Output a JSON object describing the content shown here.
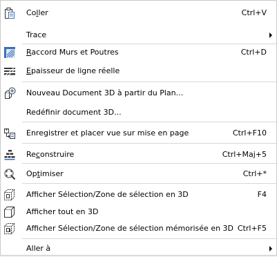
{
  "menu": {
    "items": [
      {
        "name": "coller",
        "icon": "paste-icon",
        "pre": "Co",
        "ul": "l",
        "post": "ler",
        "shortcut": "Ctrl+V",
        "submenu": false
      },
      {
        "name": "trace",
        "icon": "",
        "pre": "",
        "ul": "",
        "post": "Trace",
        "shortcut": "",
        "submenu": true
      },
      {
        "name": "raccord-murs-poutres",
        "icon": "wall-beam-join-icon",
        "pre": "",
        "ul": "R",
        "post": "accord Murs et Poutres",
        "shortcut": "Ctrl+D",
        "submenu": false
      },
      {
        "name": "epaisseur-ligne",
        "icon": "line-weight-icon",
        "pre": "",
        "ul": "E",
        "post": "paisseur de ligne réelle",
        "shortcut": "",
        "submenu": false
      },
      {
        "name": "nouveau-document-3d",
        "icon": "new-3d-document-icon",
        "pre": "",
        "ul": "",
        "post": "Nouveau Document 3D à partir du Plan...",
        "shortcut": "",
        "submenu": false
      },
      {
        "name": "redefinir-document-3d",
        "icon": "",
        "pre": "",
        "ul": "",
        "post": "Redéfinir document 3D...",
        "shortcut": "",
        "submenu": false
      },
      {
        "name": "enregistrer-placer-vue",
        "icon": "save-place-view-icon",
        "pre": "",
        "ul": "",
        "post": "Enregistrer et placer vue sur mise en page",
        "shortcut": "Ctrl+F10",
        "submenu": false
      },
      {
        "name": "reconstruire",
        "icon": "rebuild-icon",
        "pre": "Re",
        "ul": "c",
        "post": "onstruire",
        "shortcut": "Ctrl+Maj+5",
        "submenu": false
      },
      {
        "name": "optimiser",
        "icon": "zoom-fit-icon",
        "pre": "Op",
        "ul": "t",
        "post": "imiser",
        "shortcut": "Ctrl+*",
        "submenu": false
      },
      {
        "name": "afficher-selection-3d",
        "icon": "selection-3d-icon",
        "pre": "",
        "ul": "",
        "post": "Afficher Sélection/Zone de sélection en 3D",
        "shortcut": "F4",
        "submenu": false
      },
      {
        "name": "afficher-tout-3d",
        "icon": "all-3d-icon",
        "pre": "",
        "ul": "",
        "post": "Afficher tout en 3D",
        "shortcut": "",
        "submenu": false
      },
      {
        "name": "afficher-selection-memorisee-3d",
        "icon": "stored-selection-3d-icon",
        "pre": "",
        "ul": "",
        "post": "Afficher Sélection/Zone de sélection mémorisée en 3D",
        "shortcut": "Ctrl+F5",
        "submenu": false
      },
      {
        "name": "aller-a",
        "icon": "",
        "pre": "",
        "ul": "",
        "post": "Aller à",
        "shortcut": "",
        "submenu": true
      }
    ]
  },
  "colors": {
    "icon_blue": "#3a6fb6",
    "icon_dark": "#333333",
    "separator": "#d7d7d7"
  }
}
